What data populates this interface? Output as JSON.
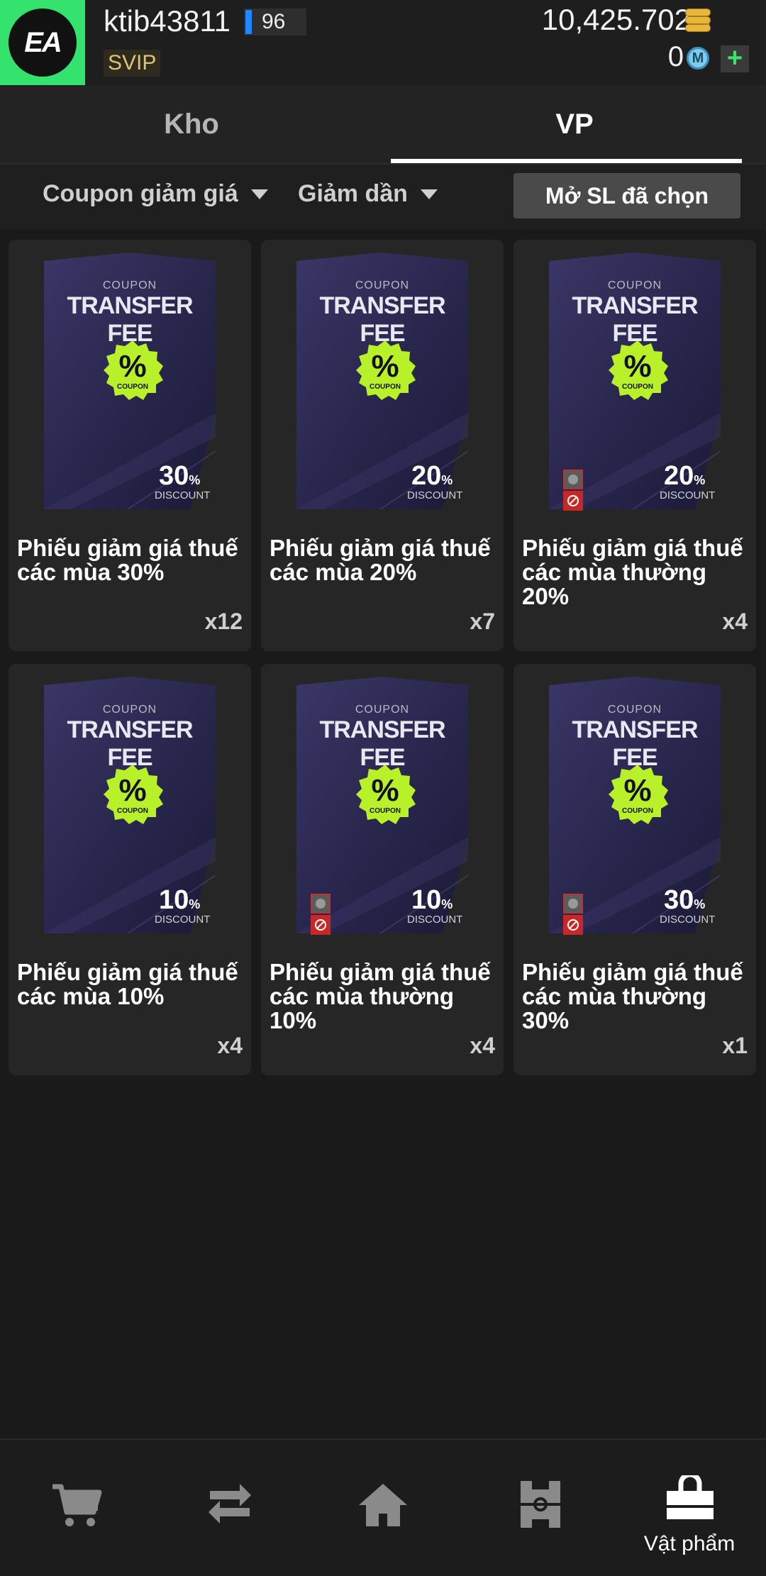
{
  "header": {
    "logo": "EA",
    "username": "ktib43811",
    "level": "96",
    "vip": "SVIP",
    "balance": "10,425.702B",
    "m_coins": "0",
    "m_icon_letter": "M",
    "plus_label": "+"
  },
  "tabs": [
    {
      "label": "Kho",
      "active": false
    },
    {
      "label": "VP",
      "active": true
    }
  ],
  "filter": {
    "category": "Coupon giảm giá",
    "sort": "Giảm dần",
    "open_selected": "Mở SL đã chọn"
  },
  "items": [
    {
      "coupon_label": "COUPON",
      "fee_label": "TRANSFER FEE",
      "badge_percent": "%",
      "badge_label": "COUPON",
      "percent": "30",
      "discount_label": "DISCOUNT",
      "name": "Phiếu giảm giá thuế các mùa 30%",
      "quantity": "x12",
      "restricted": false
    },
    {
      "coupon_label": "COUPON",
      "fee_label": "TRANSFER FEE",
      "badge_percent": "%",
      "badge_label": "COUPON",
      "percent": "20",
      "discount_label": "DISCOUNT",
      "name": "Phiếu giảm giá thuế các mùa 20%",
      "quantity": "x7",
      "restricted": false
    },
    {
      "coupon_label": "COUPON",
      "fee_label": "TRANSFER FEE",
      "badge_percent": "%",
      "badge_label": "COUPON",
      "percent": "20",
      "discount_label": "DISCOUNT",
      "name": "Phiếu giảm giá thuế các mùa thường 20%",
      "quantity": "x4",
      "restricted": true
    },
    {
      "coupon_label": "COUPON",
      "fee_label": "TRANSFER FEE",
      "badge_percent": "%",
      "badge_label": "COUPON",
      "percent": "10",
      "discount_label": "DISCOUNT",
      "name": "Phiếu giảm giá thuế các mùa 10%",
      "quantity": "x4",
      "restricted": false
    },
    {
      "coupon_label": "COUPON",
      "fee_label": "TRANSFER FEE",
      "badge_percent": "%",
      "badge_label": "COUPON",
      "percent": "10",
      "discount_label": "DISCOUNT",
      "name": "Phiếu giảm giá thuế các mùa thường 10%",
      "quantity": "x4",
      "restricted": true
    },
    {
      "coupon_label": "COUPON",
      "fee_label": "TRANSFER FEE",
      "badge_percent": "%",
      "badge_label": "COUPON",
      "percent": "30",
      "discount_label": "DISCOUNT",
      "name": "Phiếu giảm giá thuế các mùa thường 30%",
      "quantity": "x1",
      "restricted": true
    }
  ],
  "bottom_nav": [
    {
      "icon": "cart-icon",
      "label": ""
    },
    {
      "icon": "transfer-icon",
      "label": ""
    },
    {
      "icon": "home-icon",
      "label": ""
    },
    {
      "icon": "field-icon",
      "label": ""
    },
    {
      "icon": "bag-icon",
      "label": "Vật phẩm",
      "active": true
    }
  ],
  "colors": {
    "brand_green": "#34e36e",
    "card_bg": "#262626",
    "badge_green": "#b8f02a",
    "coupon_purple": "#2d2a55"
  }
}
